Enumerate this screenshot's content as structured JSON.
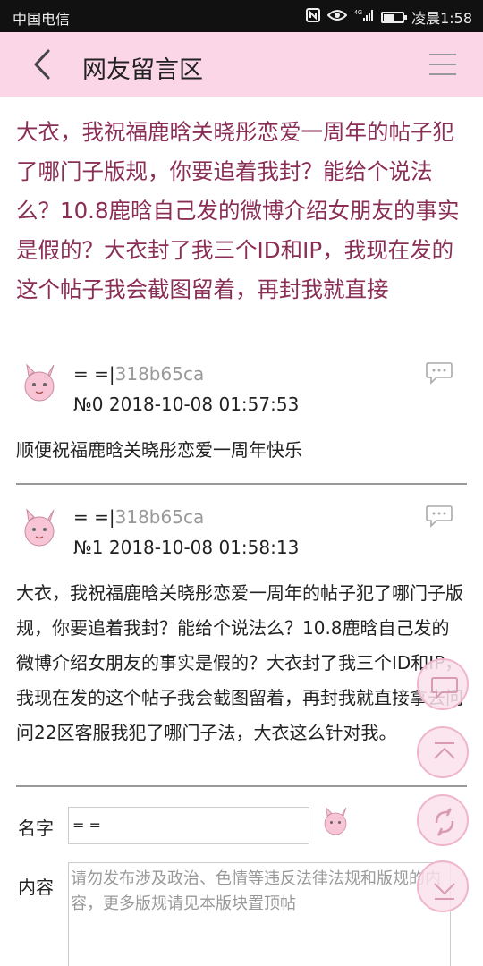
{
  "status_bar": {
    "carrier": "中国电信",
    "network": "4G",
    "time": "凌晨1:58",
    "icons": [
      "nfc-icon",
      "eye-icon",
      "signal-icon",
      "battery-icon"
    ],
    "battery_level": 0.55
  },
  "header": {
    "title": "网友留言区",
    "back_icon": "chevron-left-icon",
    "menu_icon": "hamburger-menu-icon"
  },
  "thread": {
    "title": "大衣，我祝福鹿晗关晓彤恋爱一周年的帖子犯了哪门子版规，你要追着我封？能给个说法么？10.8鹿晗自己发的微博介绍女朋友的事实是假的？大衣封了我三个ID和IP，我现在发的这个帖子我会截图留着，再封我就直接"
  },
  "posts": [
    {
      "user_prefix": "= =|",
      "user_id": "318b65ca",
      "meta": "№0  2018-10-08 01:57:53",
      "body": "顺便祝福鹿晗关晓彤恋爱一周年快乐"
    },
    {
      "user_prefix": "= =|",
      "user_id": "318b65ca",
      "meta": "№1  2018-10-08 01:58:13",
      "body": "大衣，我祝福鹿晗关晓彤恋爱一周年的帖子犯了哪门子版规，你要追着我封？能给个说法么？10.8鹿晗自己发的微博介绍女朋友的事实是假的？大衣封了我三个ID和IP，我现在发的这个帖子我会截图留着，再封我就直接拿去问问22区客服我犯了哪门子法，大衣这么针对我。"
    }
  ],
  "form": {
    "name_label": "名字",
    "name_value": "= =",
    "content_label": "内容",
    "content_placeholder": "请勿发布涉及政治、色情等违反法律法规和版规的内容，更多版规请见本版块置顶帖"
  },
  "floating_buttons": [
    "comment-fab-icon",
    "scroll-top-icon",
    "refresh-icon",
    "scroll-bottom-icon"
  ],
  "colors": {
    "header_bg": "#fbd6e6",
    "title_color": "#8a2e55",
    "fab_border": "#eeb5cb"
  }
}
